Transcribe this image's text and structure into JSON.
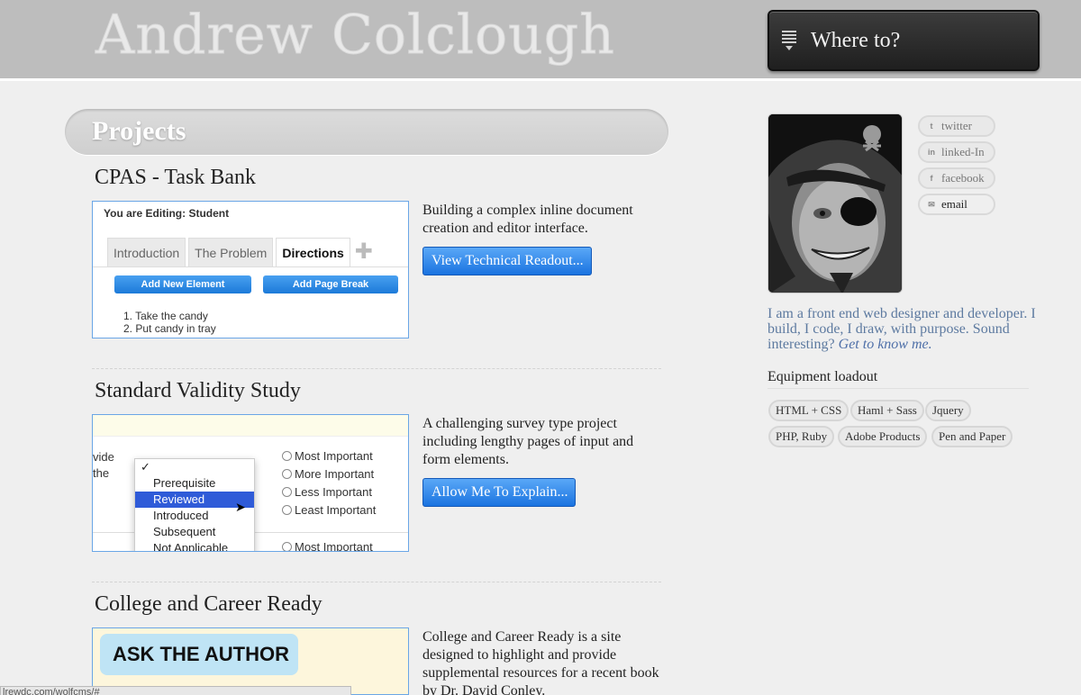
{
  "header": {
    "site_title": "Andrew Colclough",
    "nav_label": "Where to?"
  },
  "section": {
    "title": "Projects"
  },
  "projects": [
    {
      "title": "CPAS - Task Bank",
      "description": "Building a complex inline document creation and editor interface.",
      "button": "View Technical Readout..."
    },
    {
      "title": "Standard Validity Study",
      "description": "A challenging survey type project including lengthy pages of input and form elements.",
      "button": "Allow Me To Explain..."
    },
    {
      "title": "College and Career Ready",
      "description": "College and Career Ready is a site designed to highlight and provide supplemental resources for a recent book by Dr. David Conley."
    }
  ],
  "thumb1": {
    "editing": "You are Editing: Student",
    "tabs": [
      "Introduction",
      "The Problem",
      "Directions"
    ],
    "btn_add_element": "Add New Element",
    "btn_add_page": "Add Page Break",
    "list": [
      "1.  Take the candy",
      "2.  Put candy in tray"
    ]
  },
  "thumb2": {
    "left_text": [
      "vide",
      "the"
    ],
    "menu": [
      "✓",
      "Prerequisite",
      "Reviewed",
      "Introduced",
      "Subsequent",
      "Not Applicable"
    ],
    "radios": [
      "Most Important",
      "More Important",
      "Less Important",
      "Least Important",
      "Most Important"
    ]
  },
  "thumb3": {
    "bubble": "ASK THE AUTHOR"
  },
  "social": [
    "twitter",
    "linked-In",
    "facebook",
    "email"
  ],
  "bio": {
    "text": "I am a front end web designer and developer. I build, I code, I draw, with purpose. Sound interesting?",
    "link": "Get to know me."
  },
  "equipment": {
    "title": "Equipment loadout",
    "tags": [
      "HTML + CSS",
      "Haml + Sass",
      "Jquery",
      "PHP, Ruby",
      "Adobe Products",
      "Pen and Paper"
    ]
  },
  "status_bar": "lrewdc.com/wolfcms/#",
  "icons": {
    "nav": "list-menu-icon",
    "social": [
      "twitter-icon",
      "linkedin-icon",
      "facebook-icon",
      "email-icon"
    ]
  }
}
